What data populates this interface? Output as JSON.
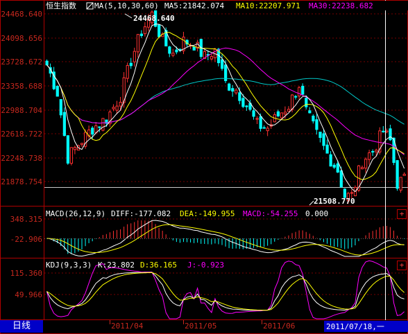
{
  "colors": {
    "background": "#000000",
    "frame": "#b00000",
    "axis_text": "#c8281e",
    "up": "#ff3232",
    "down": "#00ffff",
    "ma5": "#ffffff",
    "ma10": "#ffff00",
    "ma30": "#ff00ff",
    "ma60": "#00ff00",
    "cursor": "#ffffff",
    "tab_bg": "#0000c8"
  },
  "main_header": {
    "name": "恒生指数",
    "ma_params": "MA(5,10,30,60)",
    "ma5": "MA5:21842.074",
    "ma10": "MA10:22207.971",
    "ma30": "MA30:22238.682"
  },
  "price_axis": [
    "24468.640",
    "24098.656",
    "23728.672",
    "23358.688",
    "22988.704",
    "22618.722",
    "22248.738",
    "21878.754"
  ],
  "price_range": [
    21700,
    24500
  ],
  "high_label": "24468.640",
  "low_label": "21508.770",
  "macd_header": {
    "params": "MACD(26,12,9)",
    "diff": "DIFF:-177.082",
    "dea": "DEA:-149.955",
    "macd": "MACD:-54.255",
    "zero": "0.000"
  },
  "macd_axis": [
    "348.315",
    "-22.906"
  ],
  "kdj_header": {
    "params": "KDJ(9,3,3)",
    "k": "K:23.802",
    "d": "D:36.165",
    "j": "J:-0.923"
  },
  "kdj_axis": [
    "115.360",
    "49.966"
  ],
  "date_labels": [
    "2011/04",
    "2011/05",
    "2011/06"
  ],
  "cursor_date": "2011/07/18,一",
  "period_tab": "日线",
  "plus_symbol": "+",
  "chart_data": {
    "type": "candlestick",
    "xlabel": "",
    "ylabel": "",
    "ylim": [
      21700,
      24500
    ],
    "x_range": [
      "2011/03",
      "2011/07/18"
    ],
    "grid": true,
    "annotations": [
      "24468.640",
      "21508.770"
    ],
    "series": [
      {
        "name": "MA5",
        "value": 21842.074
      },
      {
        "name": "MA10",
        "value": 22207.971
      },
      {
        "name": "MA30",
        "value": 22238.682
      }
    ]
  }
}
